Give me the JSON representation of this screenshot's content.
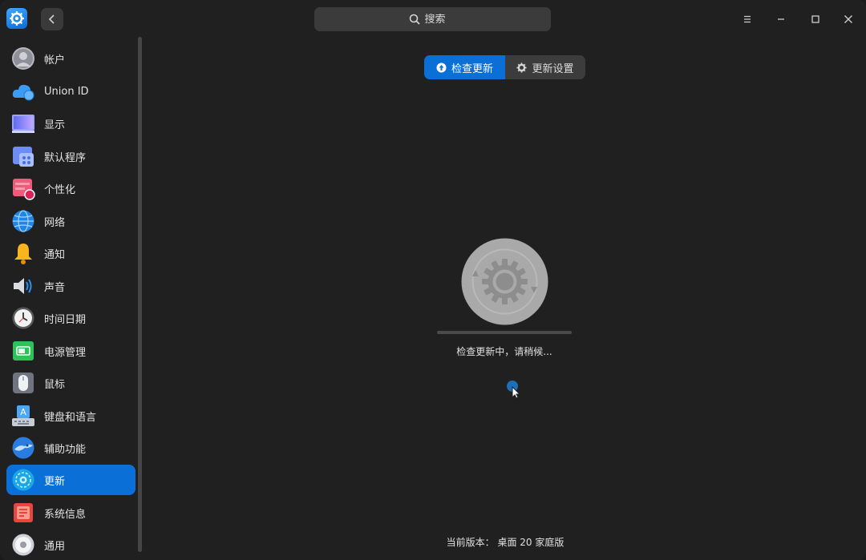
{
  "titlebar": {
    "search_label": "搜索"
  },
  "sidebar": {
    "items": [
      {
        "label": "帐户",
        "icon": "account-icon"
      },
      {
        "label": "Union ID",
        "icon": "cloud-icon"
      },
      {
        "label": "显示",
        "icon": "display-icon"
      },
      {
        "label": "默认程序",
        "icon": "default-apps-icon"
      },
      {
        "label": "个性化",
        "icon": "personalization-icon"
      },
      {
        "label": "网络",
        "icon": "network-icon"
      },
      {
        "label": "通知",
        "icon": "bell-icon"
      },
      {
        "label": "声音",
        "icon": "speaker-icon"
      },
      {
        "label": "时间日期",
        "icon": "clock-icon"
      },
      {
        "label": "电源管理",
        "icon": "battery-icon"
      },
      {
        "label": "鼠标",
        "icon": "mouse-icon"
      },
      {
        "label": "键盘和语言",
        "icon": "keyboard-icon"
      },
      {
        "label": "辅助功能",
        "icon": "accessibility-icon"
      },
      {
        "label": "更新",
        "icon": "update-icon",
        "active": true
      },
      {
        "label": "系统信息",
        "icon": "system-info-icon"
      },
      {
        "label": "通用",
        "icon": "general-icon"
      }
    ]
  },
  "main": {
    "tabs": [
      {
        "label": "检查更新",
        "active": true
      },
      {
        "label": "更新设置",
        "active": false
      }
    ],
    "status": "检查更新中，请稍候...",
    "version": "当前版本：  桌面 20 家庭版",
    "progress_fraction": 0
  },
  "colors": {
    "accent": "#0b6fd8",
    "background": "#202020"
  }
}
